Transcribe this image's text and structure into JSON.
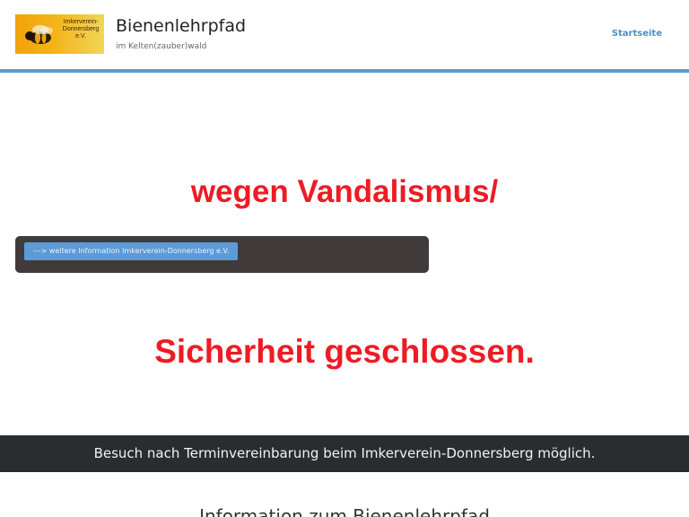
{
  "header": {
    "logo_text": "Imkerverein-Donnersberg e.V.",
    "site_title": "Bienenlehrpfad",
    "tagline": "im Kelten(zauber)wald",
    "nav": {
      "home_label": "Startseite"
    },
    "accent_color": "#5b9bd0"
  },
  "hero": {
    "line1": "wegen Vandalismus/",
    "line2": "Sicherheit geschlossen.",
    "text_color": "#ee1b24",
    "button_label": "---> weitere Information Imkerverein-Donnersberg e.V."
  },
  "notice": {
    "text": "Besuch nach Terminvereinbarung beim Imkerverein-Donnersberg möglich."
  },
  "section": {
    "heading": "Information zum Bienenlehrpfad"
  },
  "icons": {
    "logo_image": "bee-icon"
  }
}
